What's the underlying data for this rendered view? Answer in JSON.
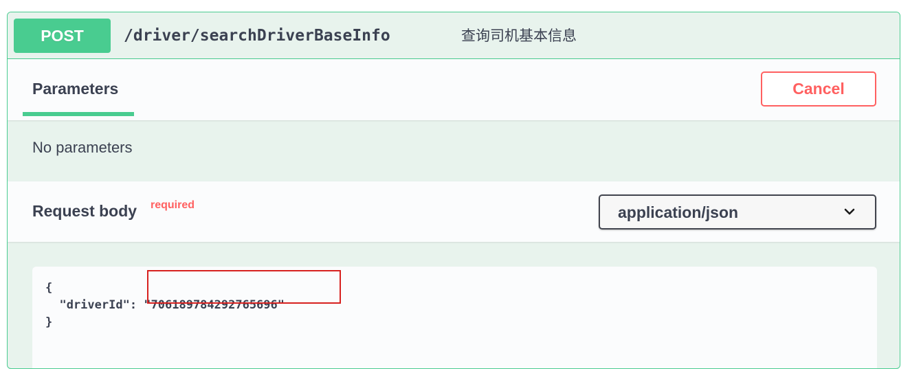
{
  "operation": {
    "method": "POST",
    "path": "/driver/searchDriverBaseInfo",
    "description": "查询司机基本信息"
  },
  "parameters": {
    "tab_label": "Parameters",
    "cancel_label": "Cancel",
    "empty_text": "No parameters"
  },
  "request_body": {
    "title": "Request body",
    "required_label": "required",
    "content_type": "application/json",
    "code_open": "{",
    "code_key": "  \"driverId\": ",
    "code_value": "\"706189784292765696\"",
    "code_close": "}"
  },
  "colors": {
    "post_accent": "#49cc90",
    "cancel_red": "#ff6060",
    "highlight_red": "#d7201e",
    "text": "#3b4151"
  },
  "icons": {
    "select_chevron": "chevron-down-icon"
  }
}
